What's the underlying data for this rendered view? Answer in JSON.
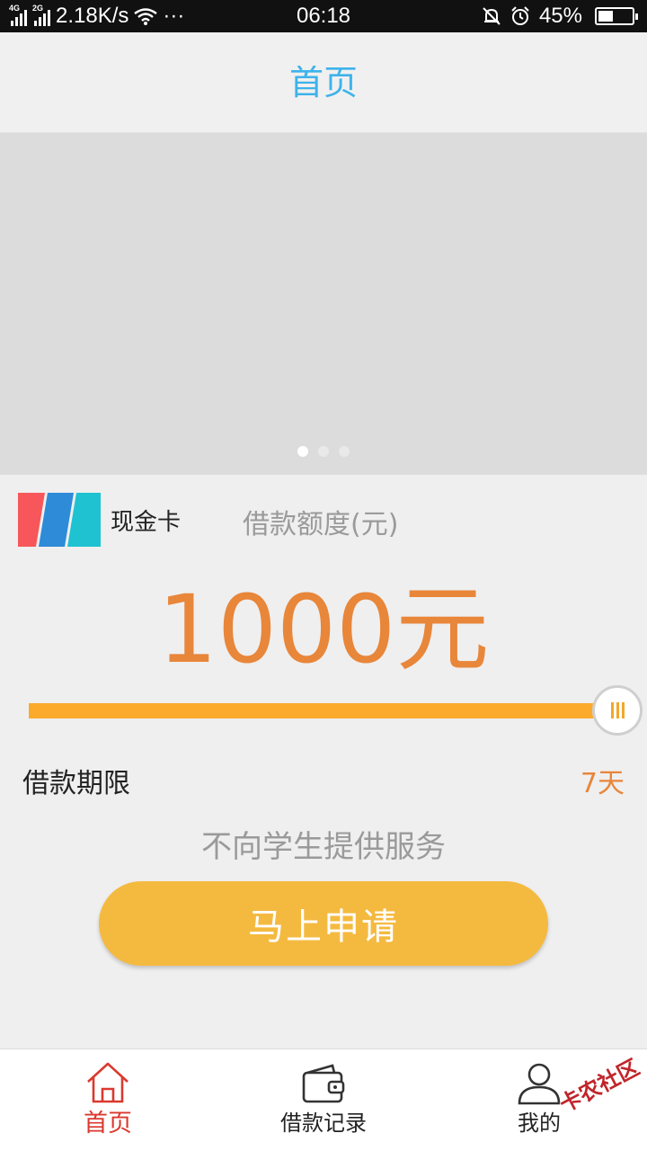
{
  "status_bar": {
    "network_1": "4G",
    "network_2": "2G",
    "speed": "2.18K/s",
    "more": "···",
    "time": "06:18",
    "battery": "45%",
    "battery_level": 0.45
  },
  "header": {
    "title": "首页"
  },
  "banner": {
    "page_count": 3,
    "active_index": 0
  },
  "product": {
    "name": "现金卡",
    "limit_label": "借款额度(元)"
  },
  "amount": {
    "display": "1000元",
    "slider_value": 1.0
  },
  "term": {
    "label": "借款期限",
    "value": "7天"
  },
  "notice": "不向学生提供服务",
  "apply_button": "马上申请",
  "tabs": [
    {
      "label": "首页",
      "icon": "home-icon",
      "active": true
    },
    {
      "label": "借款记录",
      "icon": "wallet-icon",
      "active": false
    },
    {
      "label": "我的",
      "icon": "user-icon",
      "active": false
    }
  ],
  "watermark": "卡农社区",
  "colors": {
    "accent_blue": "#3db3ea",
    "amount_orange": "#e8863a",
    "slider": "#fbaa2b",
    "button": "#f4ba40",
    "active_tab": "#d93a2f"
  }
}
